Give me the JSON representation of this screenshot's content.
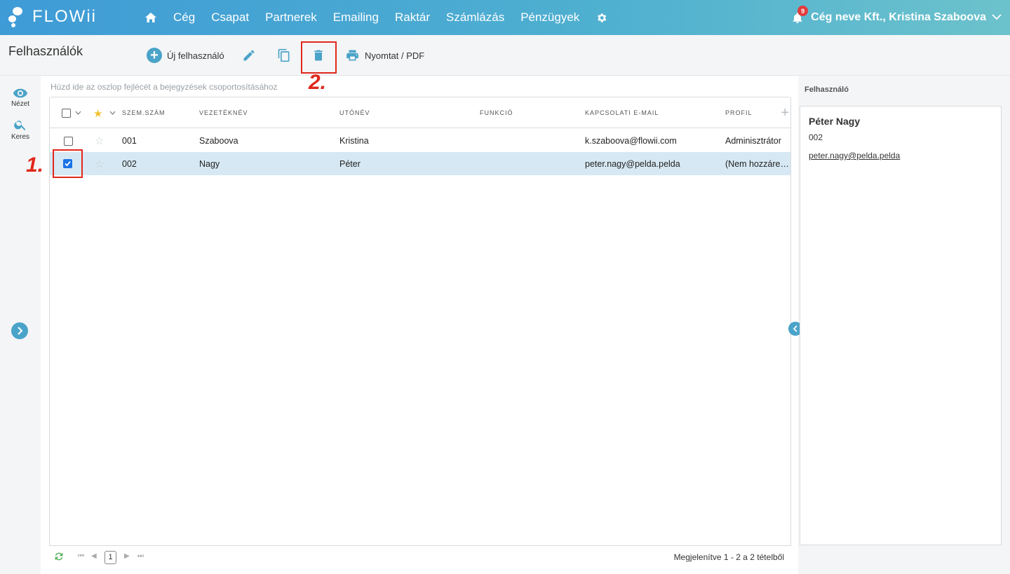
{
  "brand": {
    "name": "FLOWii"
  },
  "nav": {
    "items": [
      "Cég",
      "Csapat",
      "Partnerek",
      "Emailing",
      "Raktár",
      "Számlázás",
      "Pénzügyek"
    ]
  },
  "user": {
    "notifications": "9",
    "label": "Cég neve Kft., Kristina Szaboova"
  },
  "toolbar": {
    "title": "Felhasználók",
    "new_user": "Új felhasználó",
    "print": "Nyomtat / PDF"
  },
  "annotations": {
    "step1": "1.",
    "step2": "2."
  },
  "rail": {
    "view": "Nézet",
    "search": "Keres"
  },
  "grid": {
    "group_hint": "Húzd ide az oszlop fejlécét a bejegyzések csoportosításához",
    "columns": [
      "SZEM.SZÁM",
      "VEZETÉKNÉV",
      "UTÓNÉV",
      "FUNKCIÓ",
      "KAPCSOLATI E-MAIL",
      "PROFIL"
    ],
    "rows": [
      {
        "id": "001",
        "last": "Szaboova",
        "first": "Kristina",
        "func": "",
        "email": "k.szaboova@flowii.com",
        "profile": "Adminisztrátor",
        "checked": false
      },
      {
        "id": "002",
        "last": "Nagy",
        "first": "Péter",
        "func": "",
        "email": "peter.nagy@pelda.pelda",
        "profile": "(Nem hozzáre…",
        "checked": true
      }
    ]
  },
  "pager": {
    "page": "1",
    "status": "Megjelenítve 1 - 2 a 2 tételből"
  },
  "detail": {
    "tab": "Felhasználó",
    "name": "Péter Nagy",
    "id": "002",
    "email": "peter.nagy@pelda.pelda"
  },
  "colors": {
    "accent": "#4aa3c9",
    "annotation": "#e0281c",
    "selected_row": "#d6e8f3"
  }
}
